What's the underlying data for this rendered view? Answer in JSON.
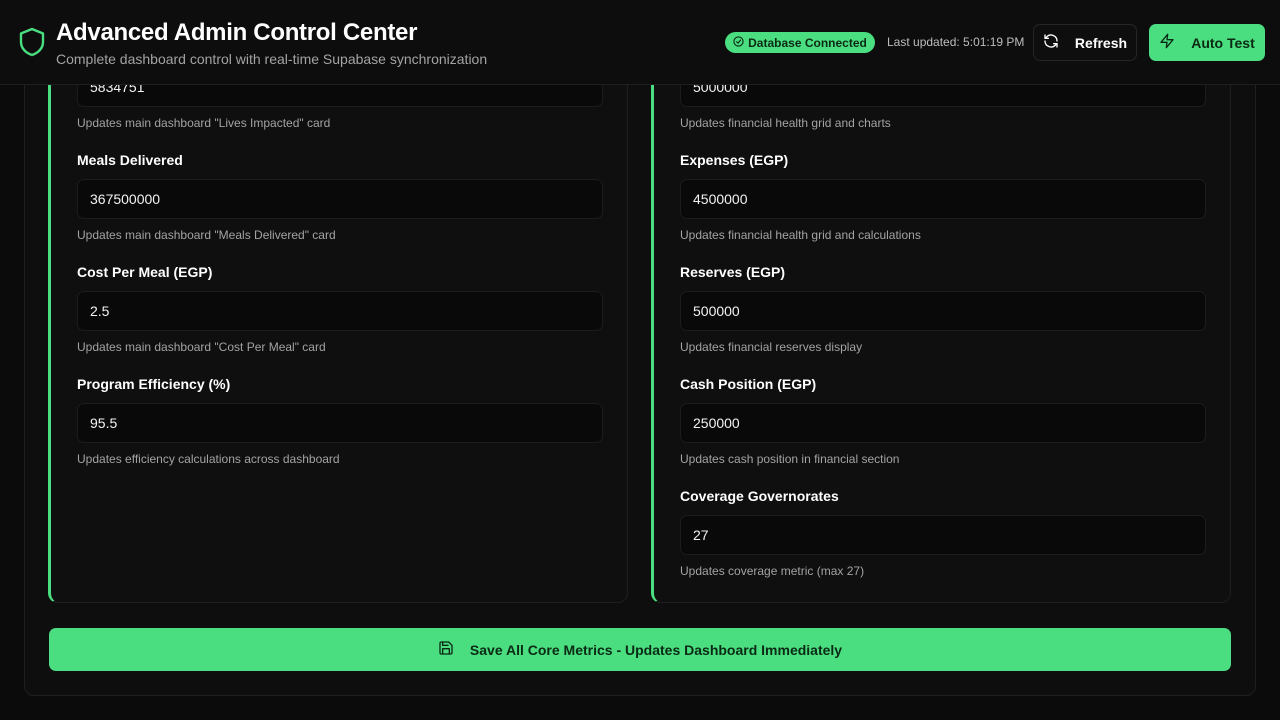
{
  "header": {
    "title": "Advanced Admin Control Center",
    "subtitle": "Complete dashboard control with real-time Supabase synchronization",
    "status": "Database Connected",
    "last_updated": "Last updated: 5:01:19 PM",
    "refresh_label": "Refresh",
    "auto_test_label": "Auto Test"
  },
  "left_fields": [
    {
      "label": "",
      "value": "5834751",
      "help": "Updates main dashboard \"Lives Impacted\" card"
    },
    {
      "label": "Meals Delivered",
      "value": "367500000",
      "help": "Updates main dashboard \"Meals Delivered\" card"
    },
    {
      "label": "Cost Per Meal (EGP)",
      "value": "2.5",
      "help": "Updates main dashboard \"Cost Per Meal\" card"
    },
    {
      "label": "Program Efficiency (%)",
      "value": "95.5",
      "help": "Updates efficiency calculations across dashboard"
    }
  ],
  "right_fields": [
    {
      "label": "",
      "value": "5000000",
      "help": "Updates financial health grid and charts"
    },
    {
      "label": "Expenses (EGP)",
      "value": "4500000",
      "help": "Updates financial health grid and calculations"
    },
    {
      "label": "Reserves (EGP)",
      "value": "500000",
      "help": "Updates financial reserves display"
    },
    {
      "label": "Cash Position (EGP)",
      "value": "250000",
      "help": "Updates cash position in financial section"
    },
    {
      "label": "Coverage Governorates",
      "value": "27",
      "help": "Updates coverage metric (max 27)"
    }
  ],
  "save_button": "Save All Core Metrics - Updates Dashboard Immediately",
  "colors": {
    "accent": "#4ade80",
    "background": "#0b0b0b"
  }
}
